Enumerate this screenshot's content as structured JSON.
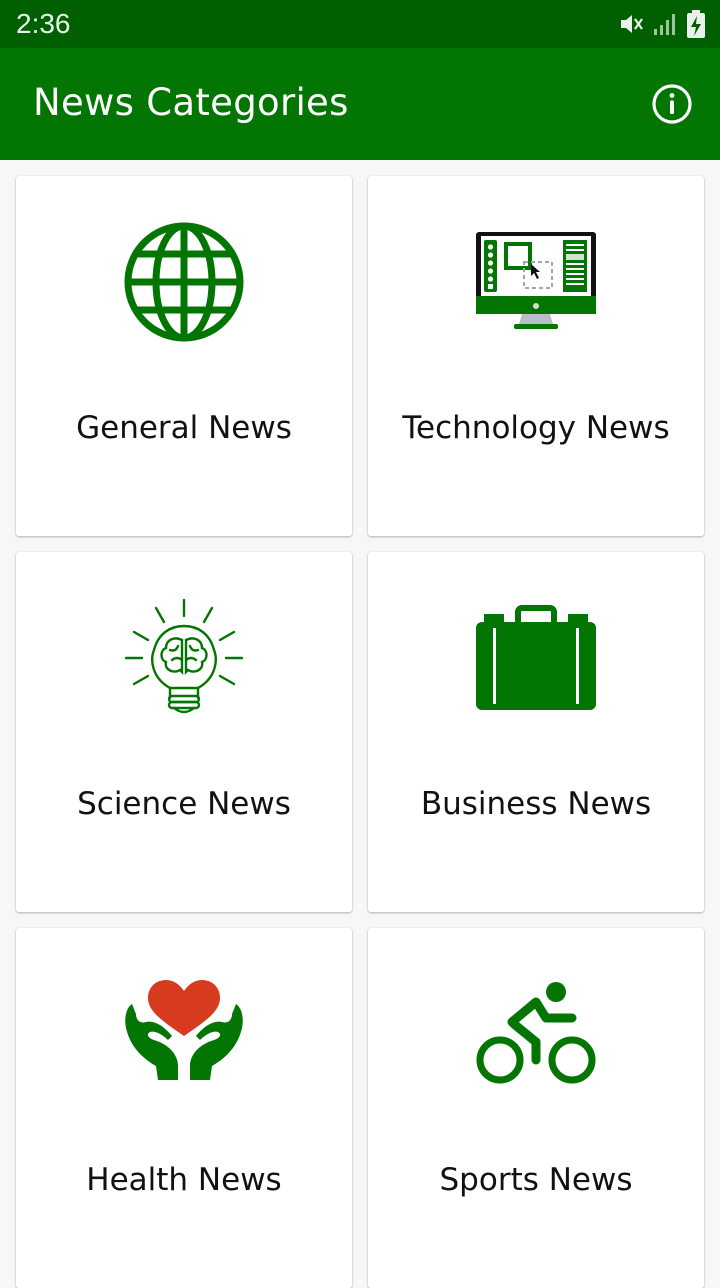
{
  "status_bar": {
    "time": "2:36",
    "icons": [
      "mute-icon",
      "signal-icon",
      "battery-charging-icon"
    ]
  },
  "app_bar": {
    "title": "News Categories",
    "info_icon": "info-icon"
  },
  "colors": {
    "status_bar": "#005f00",
    "app_bar": "#037503",
    "icon_green": "#037503",
    "heart_red": "#d63a1f",
    "background": "#f7f7f7"
  },
  "categories": [
    {
      "label": "General News",
      "icon": "globe-icon"
    },
    {
      "label": "Technology News",
      "icon": "computer-monitor-icon"
    },
    {
      "label": "Science News",
      "icon": "brain-lightbulb-icon"
    },
    {
      "label": "Business News",
      "icon": "briefcase-icon"
    },
    {
      "label": "Health News",
      "icon": "heart-hands-icon"
    },
    {
      "label": "Sports News",
      "icon": "cyclist-icon"
    }
  ]
}
